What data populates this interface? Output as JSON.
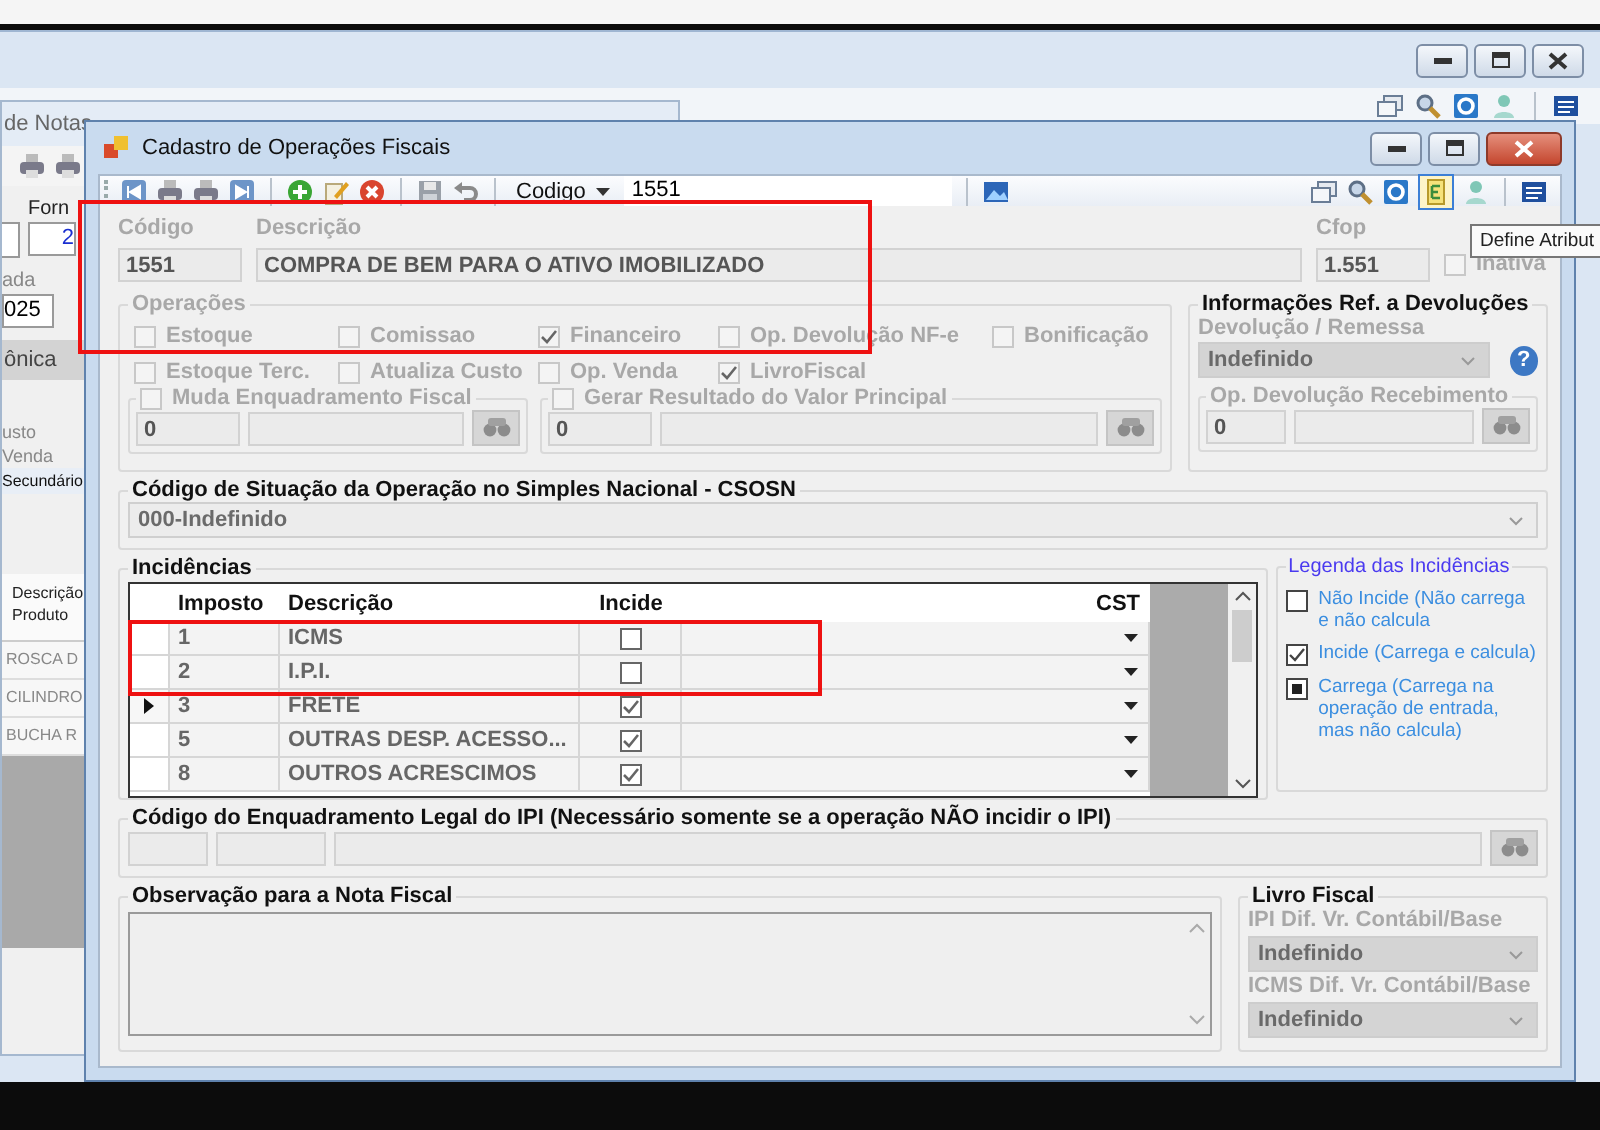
{
  "background_window": {
    "title": "de Notas",
    "fields": [
      {
        "label": "Forn",
        "value": "2"
      },
      {
        "label": "ada",
        "value": "025"
      }
    ],
    "tab": "ônica",
    "labels": [
      "usto Venda",
      "Secundário"
    ],
    "table": {
      "column": "Descrição Produto",
      "rows": [
        "ROSCA D",
        "CILINDRO",
        "BUCHA R"
      ]
    }
  },
  "dialog": {
    "title": "Cadastro de Operações Fiscais",
    "toolbar": {
      "search_by": "Codigo",
      "search_value": "1551"
    },
    "tooltip": "Define Atribut",
    "codigo": {
      "label": "Código",
      "value": "1551"
    },
    "descricao": {
      "label": "Descrição",
      "value": "COMPRA DE BEM PARA O ATIVO IMOBILIZADO"
    },
    "cfop": {
      "label": "Cfop",
      "value": "1.551"
    },
    "inativa": {
      "label": "Inativa",
      "checked": false,
      "disabled": true
    },
    "operacoes": {
      "title": "Operações",
      "disabled": true,
      "options": [
        {
          "label": "Estoque",
          "checked": false
        },
        {
          "label": "Comissao",
          "checked": false
        },
        {
          "label": "Financeiro",
          "checked": true
        },
        {
          "label": "Op. Devolução NF-e",
          "checked": false
        },
        {
          "label": "Bonificação",
          "checked": false
        },
        {
          "label": "Estoque Terc.",
          "checked": false
        },
        {
          "label": "Atualiza Custo",
          "checked": false
        },
        {
          "label": "Op. Venda",
          "checked": false
        },
        {
          "label": "LivroFiscal",
          "checked": true
        }
      ],
      "subgroups": [
        {
          "label": "Muda Enquadramento Fiscal",
          "checked": false,
          "code": "0"
        },
        {
          "label": "Gerar Resultado do Valor Principal",
          "checked": false,
          "code": "0"
        }
      ]
    },
    "devolucoes": {
      "title": "Informações Ref. a Devoluções",
      "remessa_label": "Devolução / Remessa",
      "remessa_value": "Indefinido",
      "help": "?",
      "recebimento": {
        "label": "Op. Devolução Recebimento",
        "code": "0"
      }
    },
    "csosn": {
      "title": "Código de Situação da Operação no Simples Nacional - CSOSN",
      "value": "000-Indefinido"
    },
    "incidencias": {
      "title": "Incidências",
      "columns": [
        "Imposto",
        "Descrição",
        "Incide",
        "CST"
      ],
      "rows": [
        {
          "imposto": "1",
          "descricao": "ICMS",
          "incide": false,
          "selected": false
        },
        {
          "imposto": "2",
          "descricao": "I.P.I.",
          "incide": false,
          "selected": false
        },
        {
          "imposto": "3",
          "descricao": "FRETE",
          "incide": true,
          "selected": true
        },
        {
          "imposto": "5",
          "descricao": "OUTRAS DESP. ACESSO...",
          "incide": true,
          "selected": false
        },
        {
          "imposto": "8",
          "descricao": "OUTROS ACRESCIMOS",
          "incide": true,
          "selected": false
        }
      ]
    },
    "legenda": {
      "title": "Legenda das Incidências",
      "items": [
        {
          "kind": "unchecked",
          "text": "Não Incide (Não carrega e não calcula"
        },
        {
          "kind": "checked",
          "text": "Incide (Carrega e calcula)"
        },
        {
          "kind": "filled",
          "text": "Carrega (Carrega na operação de entrada, mas não calcula)"
        }
      ]
    },
    "ipi": {
      "title": "Código do Enquadramento Legal do IPI (Necessário somente se a operação NÃO incidir o IPI)"
    },
    "observacao": {
      "title": "Observação para a Nota Fiscal"
    },
    "livro_fiscal": {
      "title": "Livro Fiscal",
      "fields": [
        {
          "label": "IPI Dif. Vr. Contábil/Base",
          "value": "Indefinido"
        },
        {
          "label": "ICMS Dif. Vr. Contábil/Base",
          "value": "Indefinido"
        }
      ]
    }
  }
}
